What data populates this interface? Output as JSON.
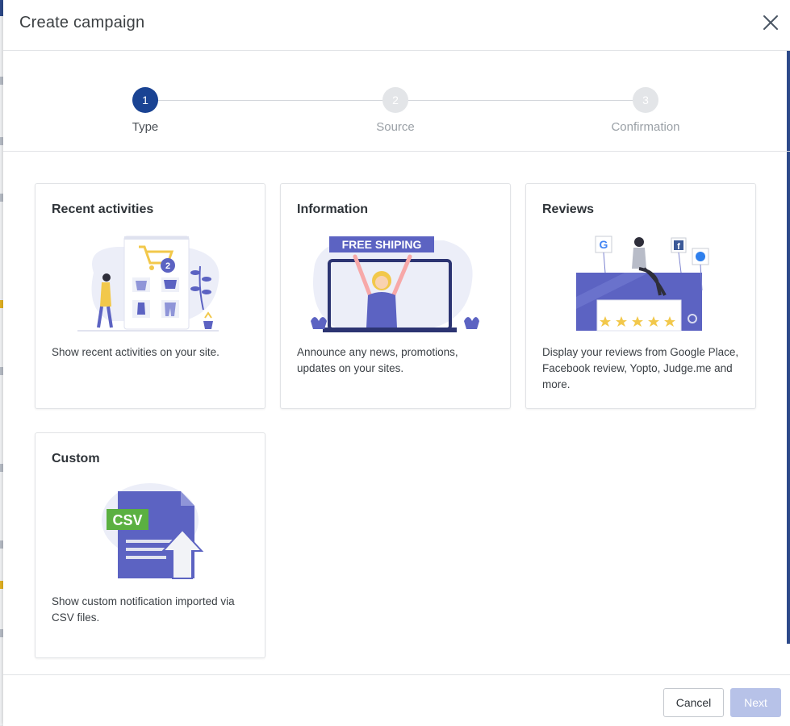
{
  "modal": {
    "title": "Create campaign"
  },
  "stepper": {
    "steps": [
      {
        "number": "1",
        "label": "Type",
        "active": true
      },
      {
        "number": "2",
        "label": "Source",
        "active": false
      },
      {
        "number": "3",
        "label": "Confirmation",
        "active": false
      }
    ]
  },
  "cards": [
    {
      "title": "Recent activities",
      "description": "Show recent activities on your site.",
      "icon": "shopping-cart-illustration"
    },
    {
      "title": "Information",
      "description": "Announce any news, promotions, updates on your sites.",
      "icon": "free-shipping-illustration",
      "banner_text": "FREE SHIPING"
    },
    {
      "title": "Reviews",
      "description": "Display your reviews from Google Place, Facebook review, Yopto, Judge.me and more.",
      "icon": "reviews-illustration"
    },
    {
      "title": "Custom",
      "description": "Show custom notification imported via CSV files.",
      "icon": "csv-upload-illustration",
      "badge_text": "CSV"
    }
  ],
  "cart_badge": "2",
  "footer": {
    "cancel_label": "Cancel",
    "next_label": "Next"
  },
  "colors": {
    "primary": "#1a4393",
    "illustration": "#5c63c2",
    "next_disabled": "#b7c2e8",
    "accent_yellow": "#f2c84b",
    "csv_green": "#5bb041"
  }
}
